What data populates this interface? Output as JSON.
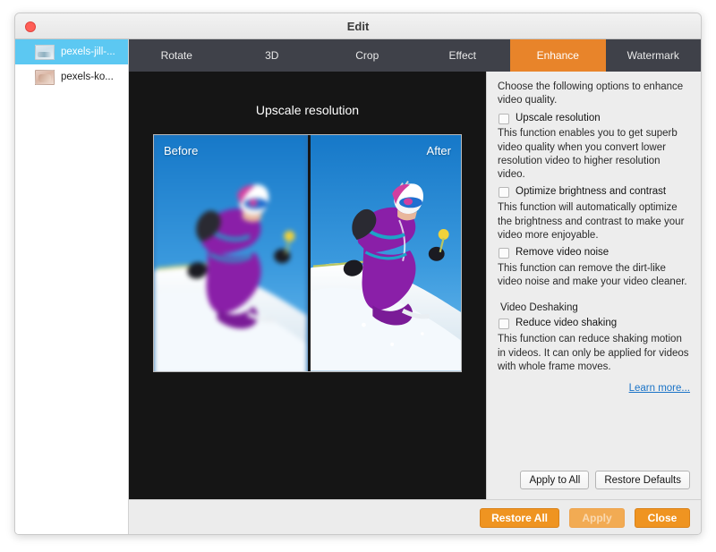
{
  "window": {
    "title": "Edit",
    "close_button": "close"
  },
  "sidebar": {
    "items": [
      {
        "label": "pexels-jill-...",
        "selected": true
      },
      {
        "label": "pexels-ko...",
        "selected": false
      }
    ]
  },
  "tabs": [
    {
      "label": "Rotate",
      "active": false
    },
    {
      "label": "3D",
      "active": false
    },
    {
      "label": "Crop",
      "active": false
    },
    {
      "label": "Effect",
      "active": false
    },
    {
      "label": "Enhance",
      "active": true
    },
    {
      "label": "Watermark",
      "active": false
    }
  ],
  "preview": {
    "title": "Upscale resolution",
    "before_label": "Before",
    "after_label": "After"
  },
  "options": {
    "intro": "Choose the following options to enhance video quality.",
    "checkboxes": [
      {
        "label": "Upscale resolution",
        "checked": false,
        "description": "This function enables you to get superb video quality when you convert lower resolution video to higher resolution video."
      },
      {
        "label": "Optimize brightness and contrast",
        "checked": false,
        "description": "This function will automatically optimize the brightness and contrast to make your video more enjoyable."
      },
      {
        "label": "Remove video noise",
        "checked": false,
        "description": "This function can remove the dirt-like video noise and make your video cleaner."
      }
    ],
    "group_title": "Video Deshaking",
    "deshake": {
      "label": "Reduce video shaking",
      "checked": false,
      "description": "This function can reduce shaking motion in videos. It can only be applied for videos with whole frame moves."
    },
    "learn_more": "Learn more...",
    "apply_to_all": "Apply to All",
    "restore_defaults": "Restore Defaults"
  },
  "footer": {
    "restore_all": "Restore All",
    "apply": "Apply",
    "apply_disabled": true,
    "close": "Close"
  },
  "colors": {
    "accent_orange": "#e8842a",
    "button_orange": "#ef9421",
    "selection_blue": "#5cc8f2",
    "link_blue": "#1a73c7",
    "tabbar_dark": "#3f4149",
    "preview_dark": "#151515",
    "panel_gray": "#ededed"
  }
}
